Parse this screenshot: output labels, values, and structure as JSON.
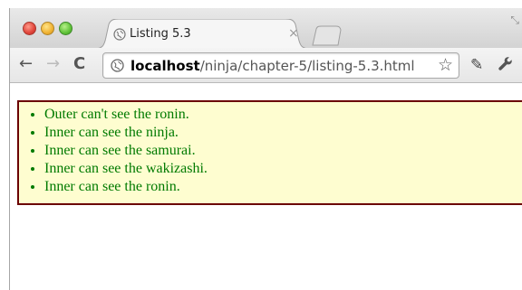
{
  "browser": {
    "tab": {
      "title": "Listing 5.3",
      "close_glyph": "×"
    },
    "nav": {
      "back": "←",
      "forward": "→",
      "reload": "C"
    },
    "address": {
      "host": "localhost",
      "path": "/ninja/chapter-5/listing-5.3.html",
      "star": "☆"
    },
    "tools": {
      "extension_glyph": "✎",
      "wrench_glyph": "🔧",
      "resize_glyph": "⤡"
    },
    "icons": [
      "globe-icon",
      "star-icon",
      "wrench-icon",
      "extension-icon",
      "back-arrow-icon",
      "forward-arrow-icon",
      "reload-icon"
    ]
  },
  "page": {
    "items": [
      "Outer can't see the ronin.",
      "Inner can see the ninja.",
      "Inner can see the samurai.",
      "Inner can see the wakizashi.",
      "Inner can see the ronin."
    ]
  },
  "colors": {
    "text_green": "#007a00",
    "box_background": "#fefdd0",
    "box_border": "#6b0000"
  }
}
